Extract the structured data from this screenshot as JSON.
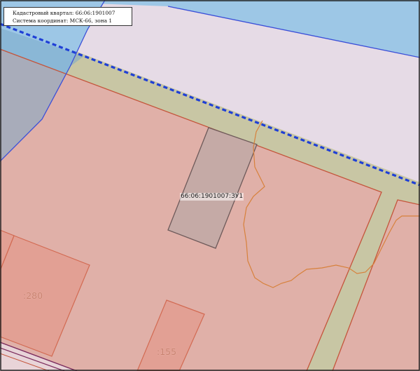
{
  "info_box": {
    "cadastral_block_line": "Кадастровый квартал: 66:06:1901007",
    "coordinate_system_line": "Система координат: МСК-66, зона 1"
  },
  "parcel_labels": {
    "main": "66:06:1901007:ЗУ1",
    "parcel_280": ":280",
    "parcel_155": ":155"
  },
  "colors": {
    "water": "#9dc7e6",
    "water_edge": "#3b4fd8",
    "road_strip": "#c8c6a4",
    "parcel_fill": "#e0b0a8",
    "parcel_edge": "#c4553b",
    "zone_north": "#e6dbe6",
    "planned_parcel_fill": "#c5aaa6",
    "planned_parcel_edge": "#6e5a5a",
    "block_boundary": "#1f3fd6",
    "contour_line": "#d7813c",
    "neighbor_parcel_fill": "#e29e90",
    "neighbor_parcel_edge": "#d26a52"
  }
}
